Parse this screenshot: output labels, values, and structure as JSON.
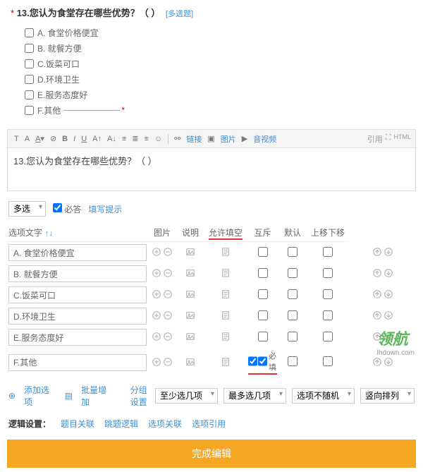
{
  "question": {
    "number": "13",
    "title": "您认为食堂存在哪些优势？（ ）",
    "tag": "[多选题]"
  },
  "preview_options": [
    {
      "label": "A. 食堂价格便宜",
      "blank": false
    },
    {
      "label": "B. 就餐方便",
      "blank": false
    },
    {
      "label": "C.饭菜可口",
      "blank": false
    },
    {
      "label": "D.环境卫生",
      "blank": false
    },
    {
      "label": "E.服务态度好",
      "blank": false
    },
    {
      "label": "F.其他",
      "blank": true
    }
  ],
  "toolbar": {
    "link": "链接",
    "image": "图片",
    "video": "音视频",
    "quote": "引用",
    "html": "HTML"
  },
  "editor_text": "13.您认为食堂存在哪些优势？（ ）",
  "type_select": "多选",
  "required_label": "必答",
  "hint_link": "填写提示",
  "table": {
    "headers": [
      "选项文字",
      "图片",
      "说明",
      "允许填空",
      "互斥",
      "默认",
      "上移下移"
    ],
    "sort": "↑↓",
    "rows": [
      {
        "text": "A. 食堂价格便宜",
        "fill_cb": false,
        "req_cb": false
      },
      {
        "text": "B. 就餐方便",
        "fill_cb": false,
        "req_cb": false
      },
      {
        "text": "C.饭菜可口",
        "fill_cb": false,
        "req_cb": false
      },
      {
        "text": "D.环境卫生",
        "fill_cb": false,
        "req_cb": false
      },
      {
        "text": "E.服务态度好",
        "fill_cb": false,
        "req_cb": false
      },
      {
        "text": "F.其他",
        "fill_cb": true,
        "req_cb": true,
        "req_label": "必填"
      }
    ]
  },
  "add_option": "添加选项",
  "batch_add": "批量增加",
  "score_setting": "分组设置",
  "min_sel": "至少选几项",
  "max_sel": "最多选几项",
  "random": "选项不随机",
  "vertical": "竖向排列",
  "logic": {
    "label": "逻辑设置：",
    "items": [
      "题目关联",
      "跳题逻辑",
      "选项关联",
      "选项引用"
    ]
  },
  "submit": "完成编辑",
  "watermark": "领航",
  "watermark_sub": "lhdown.com"
}
